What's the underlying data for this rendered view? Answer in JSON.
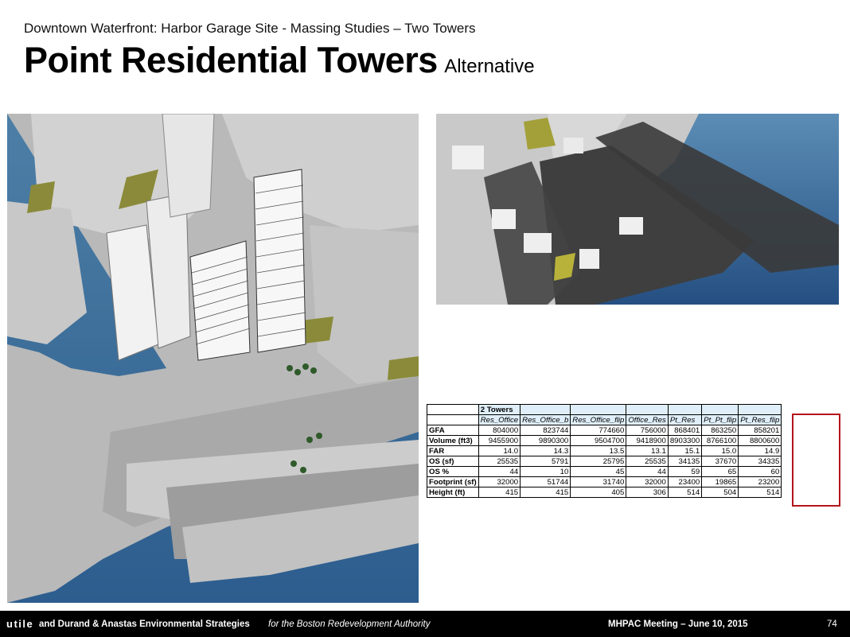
{
  "header": {
    "subtitle": "Downtown Waterfront: Harbor Garage Site - Massing Studies – Two Towers",
    "title": "Point Residential Towers",
    "title_suffix": "Alternative"
  },
  "images": {
    "left": "aerial-massing-view",
    "right": "shadow-study-view"
  },
  "table": {
    "group_header": "2 Towers",
    "columns": [
      "Res_Office",
      "Res_Office_b",
      "Res_Office_flip",
      "Office_Res",
      "Pt_Res",
      "Pt_Pt_flip",
      "Pt_Res_flip"
    ],
    "rows": [
      {
        "label": "GFA",
        "values": [
          "804000",
          "823744",
          "774660",
          "756000",
          "868401",
          "863250",
          "858201"
        ]
      },
      {
        "label": "Volume (ft3)",
        "values": [
          "9455900",
          "9890300",
          "9504700",
          "9418900",
          "8903300",
          "8766100",
          "8800600"
        ]
      },
      {
        "label": "FAR",
        "values": [
          "14.0",
          "14.3",
          "13.5",
          "13.1",
          "15.1",
          "15.0",
          "14.9"
        ]
      },
      {
        "label": "OS (sf)",
        "values": [
          "25535",
          "5791",
          "25795",
          "25535",
          "34135",
          "37670",
          "34335"
        ]
      },
      {
        "label": "OS %",
        "values": [
          "44",
          "10",
          "45",
          "44",
          "59",
          "65",
          "60"
        ]
      },
      {
        "label": "Footprint (sf)",
        "values": [
          "32000",
          "51744",
          "31740",
          "32000",
          "23400",
          "19865",
          "23200"
        ]
      },
      {
        "label": "Height (ft)",
        "values": [
          "415",
          "415",
          "405",
          "306",
          "514",
          "504",
          "514"
        ]
      }
    ],
    "highlight_color": "#b3141c"
  },
  "footer": {
    "logo": "utile",
    "credit": "and Durand & Anastas Environmental Strategies",
    "for_the": "for the Boston Redevelopment Authority",
    "meeting": "MHPAC Meeting  – June 10, 2015",
    "page": "74"
  }
}
